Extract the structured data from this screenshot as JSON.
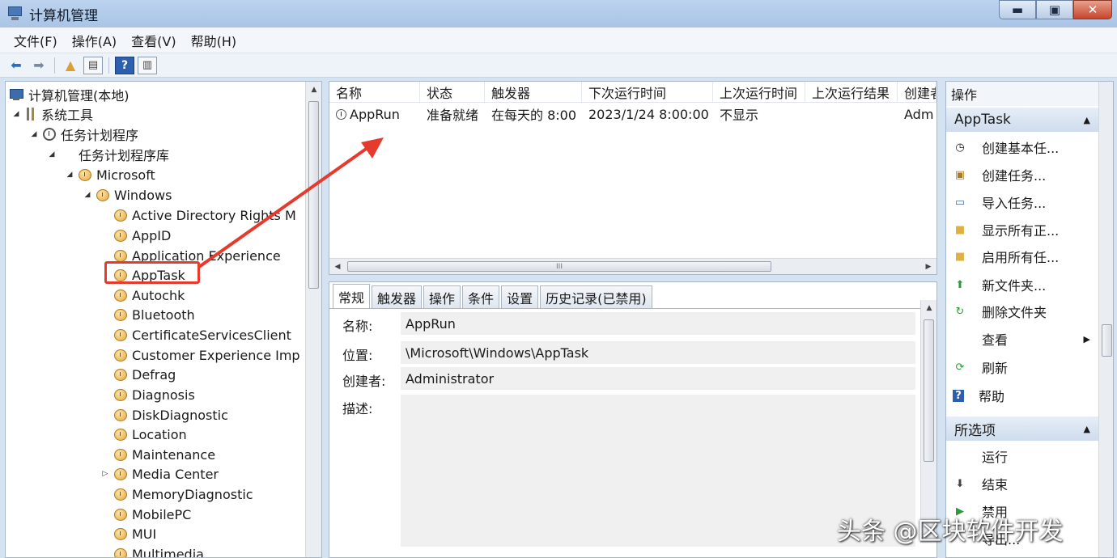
{
  "window": {
    "title": "计算机管理",
    "buttons": {
      "minimize": "▬",
      "maximize": "▣",
      "close": "✕"
    }
  },
  "menu": [
    "文件(F)",
    "操作(A)",
    "查看(V)",
    "帮助(H)"
  ],
  "toolbar": {
    "icons": [
      "back-arrow-icon",
      "forward-arrow-icon",
      "up-folder-icon",
      "show-hide-tree-icon",
      "help-icon",
      "properties-icon"
    ],
    "help_glyph": "?"
  },
  "tree": {
    "items": [
      {
        "label": "计算机管理(本地)",
        "twisty": ""
      },
      {
        "label": "系统工具",
        "twisty": "◢"
      },
      {
        "label": "任务计划程序",
        "twisty": "◢"
      },
      {
        "label": "任务计划程序库",
        "twisty": "◢"
      },
      {
        "label": "Microsoft",
        "twisty": "◢"
      },
      {
        "label": "Windows",
        "twisty": "◢"
      },
      {
        "label": "Active Directory Rights M",
        "twisty": ""
      },
      {
        "label": "AppID",
        "twisty": ""
      },
      {
        "label": "Application Experience",
        "twisty": ""
      },
      {
        "label": "AppTask",
        "twisty": ""
      },
      {
        "label": "Autochk",
        "twisty": ""
      },
      {
        "label": "Bluetooth",
        "twisty": ""
      },
      {
        "label": "CertificateServicesClient",
        "twisty": ""
      },
      {
        "label": "Customer Experience Imp",
        "twisty": ""
      },
      {
        "label": "Defrag",
        "twisty": ""
      },
      {
        "label": "Diagnosis",
        "twisty": ""
      },
      {
        "label": "DiskDiagnostic",
        "twisty": ""
      },
      {
        "label": "Location",
        "twisty": ""
      },
      {
        "label": "Maintenance",
        "twisty": ""
      },
      {
        "label": "Media Center",
        "twisty": "▷"
      },
      {
        "label": "MemoryDiagnostic",
        "twisty": ""
      },
      {
        "label": "MobilePC",
        "twisty": ""
      },
      {
        "label": "MUI",
        "twisty": ""
      },
      {
        "label": "Multimedia",
        "twisty": ""
      }
    ],
    "selected": "AppTask"
  },
  "task_list": {
    "columns": [
      "名称",
      "状态",
      "触发器",
      "下次运行时间",
      "上次运行时间",
      "上次运行结果",
      "创建者"
    ],
    "rows": [
      {
        "name": "AppRun",
        "status": "准备就绪",
        "trigger": "在每天的 8:00",
        "next_run": "2023/1/24 8:00:00",
        "last_run": "不显示",
        "last_result": "",
        "author": "Adm"
      }
    ]
  },
  "detail": {
    "tabs": [
      "常规",
      "触发器",
      "操作",
      "条件",
      "设置",
      "历史记录(已禁用)"
    ],
    "active_tab": "常规",
    "fields": {
      "name_label": "名称:",
      "name_value": "AppRun",
      "location_label": "位置:",
      "location_value": "\\Microsoft\\Windows\\AppTask",
      "author_label": "创建者:",
      "author_value": "Administrator",
      "desc_label": "描述:",
      "desc_value": ""
    }
  },
  "actions": {
    "title": "操作",
    "section1": "AppTask",
    "section1_items": [
      {
        "label": "创建基本任...",
        "icon": "clock-icon"
      },
      {
        "label": "创建任务...",
        "icon": "task-icon"
      },
      {
        "label": "导入任务...",
        "icon": "import-icon"
      },
      {
        "label": "显示所有正...",
        "icon": "folder-icon"
      },
      {
        "label": "启用所有任...",
        "icon": "folder-icon"
      },
      {
        "label": "新文件夹...",
        "icon": "new-folder-icon"
      },
      {
        "label": "删除文件夹",
        "icon": "delete-folder-icon"
      },
      {
        "label": "查看",
        "icon": ""
      },
      {
        "label": "刷新",
        "icon": "refresh-icon"
      },
      {
        "label": "帮助",
        "icon": "help-icon"
      }
    ],
    "section2": "所选项",
    "section2_items": [
      {
        "label": "运行",
        "icon": ""
      },
      {
        "label": "结束",
        "icon": "stop-icon"
      },
      {
        "label": "禁用",
        "icon": "disable-icon"
      },
      {
        "label": "导出...",
        "icon": ""
      }
    ]
  },
  "watermark": "头条 @区块软件开发",
  "colors": {
    "highlight": "#e53a2c",
    "title_bar": "#a9c4e6",
    "section_header": "#cfdced"
  }
}
